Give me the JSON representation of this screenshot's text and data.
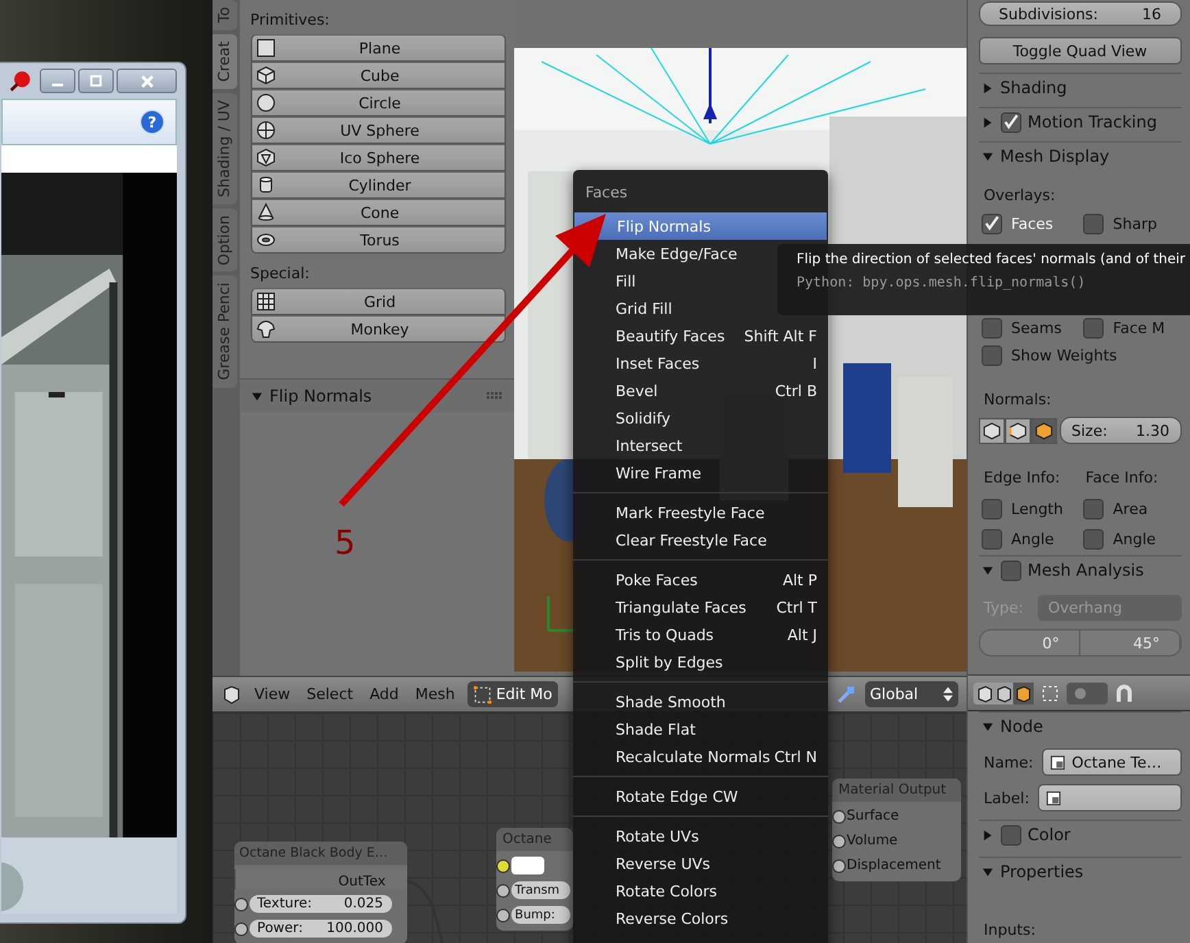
{
  "dialog": {
    "help": "?"
  },
  "tool_shelf": {
    "tabs": [
      {
        "label": "To",
        "selected": false
      },
      {
        "label": "Creat",
        "selected": true
      },
      {
        "label": "Shading / UV",
        "selected": false
      },
      {
        "label": "Option",
        "selected": false
      },
      {
        "label": "Grease Penci",
        "selected": false
      }
    ],
    "sections": [
      {
        "title": "Primitives:",
        "buttons": [
          {
            "label": "Plane"
          },
          {
            "label": "Cube"
          },
          {
            "label": "Circle"
          },
          {
            "label": "UV Sphere"
          },
          {
            "label": "Ico Sphere"
          },
          {
            "label": "Cylinder"
          },
          {
            "label": "Cone"
          },
          {
            "label": "Torus"
          }
        ]
      },
      {
        "title": "Special:",
        "buttons": [
          {
            "label": "Grid"
          },
          {
            "label": "Monkey"
          }
        ]
      }
    ],
    "operator_panel": {
      "title": "Flip Normals",
      "expanded": true
    }
  },
  "annotation": {
    "label": "5"
  },
  "menu": {
    "title": "Faces",
    "items": [
      {
        "kind": "item",
        "label": "Flip Normals",
        "selected": true
      },
      {
        "kind": "item",
        "label": "Make Edge/Face",
        "selected": false
      },
      {
        "kind": "item",
        "label": "Fill",
        "selected": false
      },
      {
        "kind": "item",
        "label": "Grid Fill",
        "selected": false
      },
      {
        "kind": "item",
        "label": "Beautify Faces",
        "shortcut": "Shift Alt F",
        "selected": false
      },
      {
        "kind": "item",
        "label": "Inset Faces",
        "shortcut": "I",
        "selected": false
      },
      {
        "kind": "item",
        "label": "Bevel",
        "shortcut": "Ctrl B",
        "selected": false
      },
      {
        "kind": "item",
        "label": "Solidify",
        "selected": false
      },
      {
        "kind": "item",
        "label": "Intersect",
        "selected": false
      },
      {
        "kind": "item",
        "label": "Wire Frame",
        "selected": false
      },
      {
        "kind": "separator"
      },
      {
        "kind": "item",
        "label": "Mark Freestyle Face",
        "selected": false
      },
      {
        "kind": "item",
        "label": "Clear Freestyle Face",
        "selected": false
      },
      {
        "kind": "separator"
      },
      {
        "kind": "item",
        "label": "Poke Faces",
        "shortcut": "Alt P",
        "selected": false
      },
      {
        "kind": "item",
        "label": "Triangulate Faces",
        "shortcut": "Ctrl T",
        "selected": false
      },
      {
        "kind": "item",
        "label": "Tris to Quads",
        "shortcut": "Alt J",
        "selected": false
      },
      {
        "kind": "item",
        "label": "Split by Edges",
        "selected": false
      },
      {
        "kind": "separator"
      },
      {
        "kind": "item",
        "label": "Shade Smooth",
        "selected": false
      },
      {
        "kind": "item",
        "label": "Shade Flat",
        "selected": false
      },
      {
        "kind": "item",
        "label": "Recalculate Normals",
        "shortcut": "Ctrl N",
        "selected": false
      },
      {
        "kind": "separator"
      },
      {
        "kind": "item",
        "label": "Rotate Edge CW",
        "selected": false
      },
      {
        "kind": "separator"
      },
      {
        "kind": "item",
        "label": "Rotate UVs",
        "selected": false
      },
      {
        "kind": "item",
        "label": "Reverse UVs",
        "selected": false
      },
      {
        "kind": "item",
        "label": "Rotate Colors",
        "selected": false
      },
      {
        "kind": "item",
        "label": "Reverse Colors",
        "selected": false
      }
    ]
  },
  "tooltip": {
    "text": "Flip the direction of selected faces' normals (and of their",
    "python": "Python: bpy.ops.mesh.flip_normals()"
  },
  "header": {
    "menus": [
      "View",
      "Select",
      "Add",
      "Mesh"
    ],
    "mode": "Edit Mo",
    "orientation": "Global"
  },
  "node_editor": {
    "nodes": [
      {
        "kind": "emission",
        "title": "Octane Black Body E…",
        "output": "OutTex",
        "fields": [
          {
            "label": "Texture:",
            "value": "0.025"
          },
          {
            "label": "Power:",
            "value": "100.000"
          }
        ]
      },
      {
        "kind": "diffuse",
        "title": "Octane",
        "fields": [
          {
            "label": "Transm"
          },
          {
            "label": "Bump:"
          }
        ]
      },
      {
        "kind": "output",
        "title": "Material Output",
        "sockets": [
          "Surface",
          "Volume",
          "Displacement"
        ]
      }
    ]
  },
  "properties": {
    "subdivisions": {
      "label": "Subdivisions:",
      "value": "16"
    },
    "toggle_button": "Toggle Quad View",
    "shading": {
      "title": "Shading",
      "expanded": false
    },
    "motion_tracking": {
      "title": "Motion Tracking",
      "expanded": false,
      "checked": true
    },
    "mesh_display": {
      "title": "Mesh Display",
      "expanded": true,
      "overlays_label": "Overlays:",
      "overlays": [
        {
          "label": "Faces",
          "checked": true
        },
        {
          "label": "Sharp",
          "checked": false
        }
      ],
      "overlays_lower": [
        {
          "label": "Seams",
          "checked": false
        },
        {
          "label": "Face M",
          "checked": false
        }
      ],
      "show_weights": {
        "label": "Show Weights",
        "checked": false
      },
      "normals_label": "Normals:",
      "normal_toggles": [
        {
          "selected": false
        },
        {
          "selected": false
        },
        {
          "selected": true
        }
      ],
      "size": {
        "label": "Size:",
        "value": "1.30"
      },
      "edge_info": {
        "label": "Edge Info:",
        "options": [
          {
            "label": "Length",
            "checked": false
          },
          {
            "label": "Angle",
            "checked": false
          }
        ]
      },
      "face_info": {
        "label": "Face Info:",
        "options": [
          {
            "label": "Area",
            "checked": false
          },
          {
            "label": "Angle",
            "checked": false
          }
        ]
      }
    },
    "mesh_analysis": {
      "title": "Mesh Analysis",
      "expanded": true,
      "checked": false,
      "type_label": "Type:",
      "type_value": "Overhang",
      "disabled": true,
      "min": "0°",
      "max": "45°"
    }
  },
  "node_panel": {
    "node": {
      "title": "Node",
      "expanded": true,
      "name_label": "Name:",
      "name_value": "Octane Te…",
      "label_label": "Label:"
    },
    "color": {
      "title": "Color",
      "expanded": false,
      "checked": false
    },
    "props": {
      "title": "Properties",
      "expanded": true,
      "inputs_label": "Inputs:"
    }
  }
}
